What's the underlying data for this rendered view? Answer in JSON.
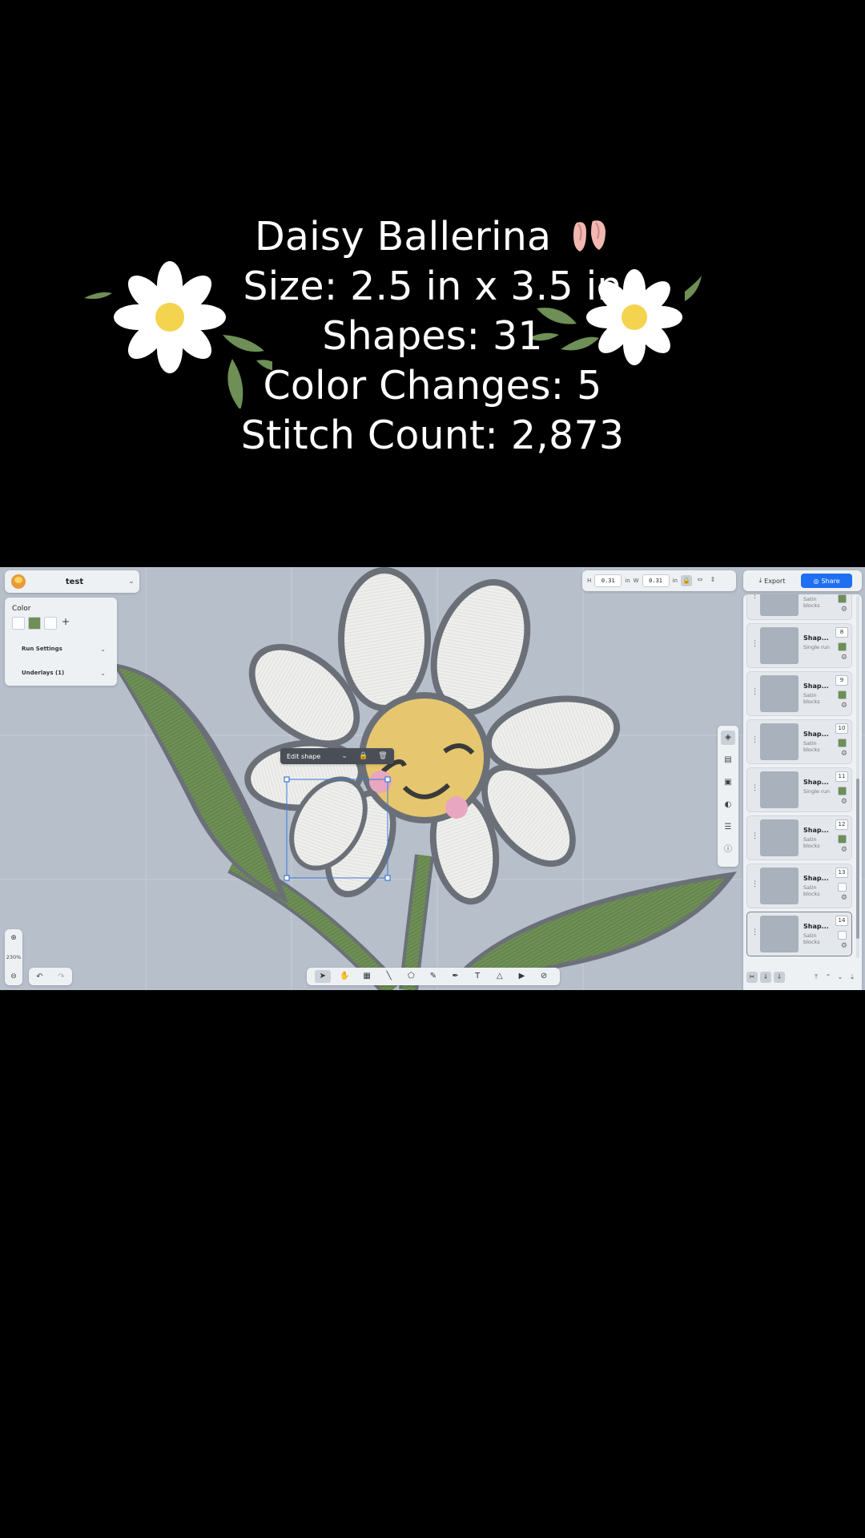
{
  "header": {
    "lines": [
      "Daisy Ballerina",
      "Size: 2.5 in x 3.5 in",
      "Shapes: 31",
      "Color Changes: 5",
      "Stitch Count: 2,873"
    ],
    "title_emoji": "ballet-shoes-icon"
  },
  "app": {
    "project": {
      "name": "test"
    },
    "color_panel": {
      "title": "Color",
      "swatches": [
        "#ffffff",
        "#6e8f55",
        "#ffffff"
      ],
      "add_label": "+",
      "sections": [
        "Run Settings",
        "Underlays (1)"
      ]
    },
    "dimensions": {
      "h_label": "H",
      "h_value": "0.31",
      "h_unit": "in",
      "w_label": "W",
      "w_value": "0.31",
      "w_unit": "in"
    },
    "actions": {
      "export_label": "Export",
      "share_label": "Share"
    },
    "edit_popup": {
      "label": "Edit shape"
    },
    "zoom": {
      "value": "230%"
    },
    "layers": [
      {
        "name": "",
        "type": "Satin blocks",
        "num": "",
        "color": "#6e8f55",
        "thumb": "stem"
      },
      {
        "name": "Shap...",
        "type": "Single run",
        "num": "8",
        "color": "#6e8f55",
        "thumb": "line"
      },
      {
        "name": "Shap...",
        "type": "Satin blocks",
        "num": "9",
        "color": "#6e8f55",
        "thumb": "leaf"
      },
      {
        "name": "Shap...",
        "type": "Satin blocks",
        "num": "10",
        "color": "#6e8f55",
        "thumb": "leaf2"
      },
      {
        "name": "Shap...",
        "type": "Single run",
        "num": "11",
        "color": "#6e8f55",
        "thumb": "line2"
      },
      {
        "name": "Shap...",
        "type": "Satin blocks",
        "num": "12",
        "color": "#6e8f55",
        "thumb": "stem2"
      },
      {
        "name": "Shap...",
        "type": "Satin blocks",
        "num": "13",
        "color": "#ffffff",
        "thumb": "petal"
      },
      {
        "name": "Shap...",
        "type": "Satin blocks",
        "num": "14",
        "color": "#ffffff",
        "thumb": "petal"
      }
    ]
  }
}
